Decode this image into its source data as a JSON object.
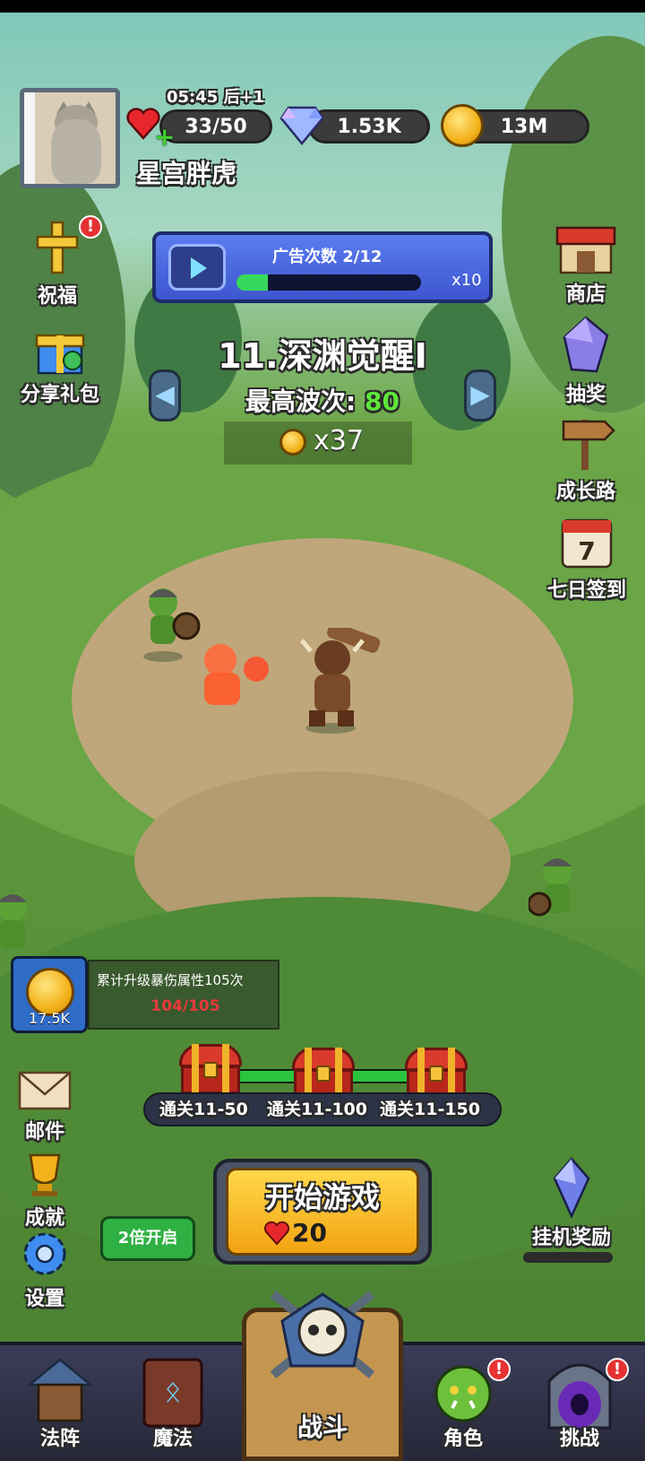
{
  "player": {
    "name": "星宫胖虎",
    "timer": "05:45 后+1"
  },
  "resources": {
    "stamina": "33/50",
    "gems": "1.53K",
    "gold": "13M"
  },
  "left_menu": {
    "blessing": "祝福",
    "share_gift": "分享礼包"
  },
  "right_menu": {
    "shop": "商店",
    "lottery": "抽奖",
    "growth_path": "成长路",
    "seven_day_signin": "七日签到",
    "signin_day": "7"
  },
  "ad_bar": {
    "label": "广告次数",
    "count": "2/12",
    "multiplier": "x10",
    "progress_fraction": 0.17
  },
  "stage": {
    "title": "11.深渊觉醒I",
    "best_wave_label": "最高波次:",
    "best_wave_value": "80",
    "coin_reward": "x37",
    "prev_arrow": "◀",
    "next_arrow": "▶"
  },
  "quest": {
    "reward_value": "17.5K",
    "description": "累计升级暴伤属性105次",
    "progress": "104/105"
  },
  "milestones": {
    "progress_fraction": 0.85,
    "items": [
      {
        "label": "通关11-50"
      },
      {
        "label": "通关11-100"
      },
      {
        "label": "通关11-150"
      }
    ]
  },
  "lower_left_menu": {
    "mail": "邮件",
    "achievements": "成就",
    "settings": "设置"
  },
  "start_game": {
    "label": "开始游戏",
    "cost": "20"
  },
  "double_speed": "2倍开启",
  "idle_reward": "挂机奖励",
  "bottom_nav": {
    "formation": "法阵",
    "magic": "魔法",
    "battle": "战斗",
    "character": "角色",
    "challenge": "挑战"
  },
  "colors": {
    "ad_bar": "#4a6ae0",
    "start_button": "#f7c42a",
    "badge": "#e63232",
    "progress_green": "#37d95d"
  },
  "badge_text": "!"
}
